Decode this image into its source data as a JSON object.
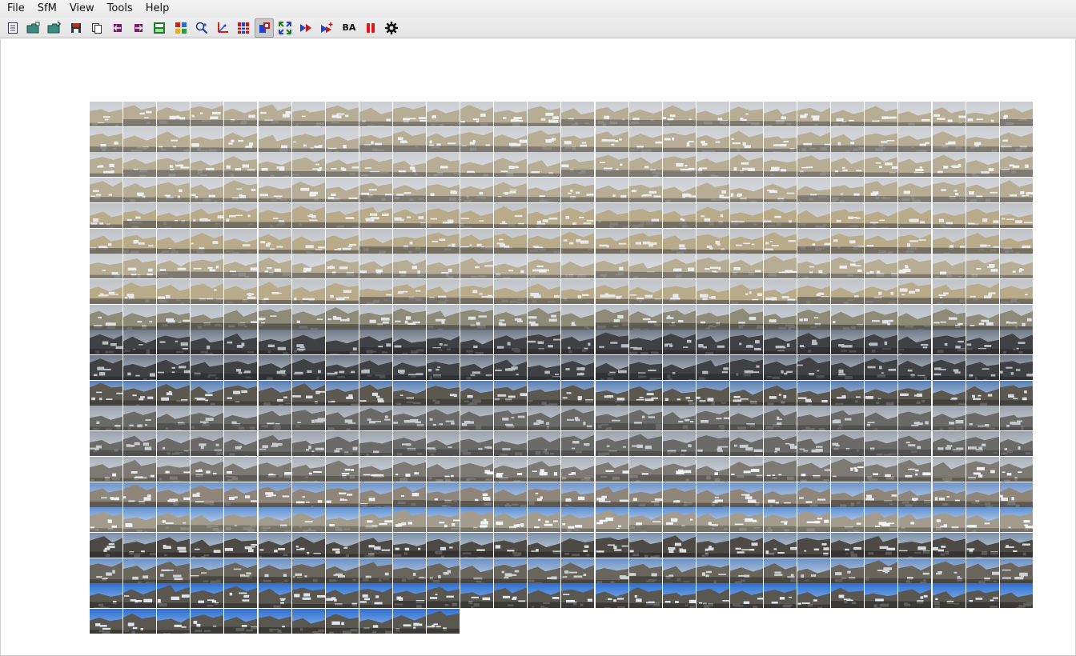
{
  "window": {
    "menu": [
      {
        "label": "File"
      },
      {
        "label": "SfM"
      },
      {
        "label": "View"
      },
      {
        "label": "Tools"
      },
      {
        "label": "Help"
      }
    ]
  },
  "toolbar": {
    "buttons": [
      {
        "icon": "new-workspace-icon"
      },
      {
        "icon": "open-folder-icon"
      },
      {
        "icon": "load-images-icon"
      },
      {
        "icon": "save-icon"
      },
      {
        "icon": "copy-icon"
      },
      {
        "icon": "import-icon"
      },
      {
        "icon": "export-icon"
      },
      {
        "icon": "2d-3d-toggle-icon"
      },
      {
        "icon": "image-grid-icon"
      },
      {
        "icon": "zoom-search-icon"
      },
      {
        "icon": "feature-match-icon"
      },
      {
        "icon": "match-matrix-icon"
      },
      {
        "icon": "image-group-icon",
        "active": true
      },
      {
        "icon": "expand-arrows-icon"
      },
      {
        "icon": "compute-sparse-icon"
      },
      {
        "icon": "add-images-icon"
      },
      {
        "icon": "bundle-adjust-icon",
        "text": "BA"
      },
      {
        "icon": "pause-icon"
      },
      {
        "icon": "settings-gear-icon"
      }
    ]
  },
  "colors": {
    "menubar": "#ececec",
    "toolbar": "#e8e8e8",
    "canvas": "#ffffff",
    "pause": "#e01818",
    "icon_blue": "#2255cc"
  },
  "thumbnails": {
    "rows": [
      {
        "count": 28,
        "tone": "snow-town"
      },
      {
        "count": 28,
        "tone": "snow-town"
      },
      {
        "count": 28,
        "tone": "snow-town"
      },
      {
        "count": 28,
        "tone": "snow-town"
      },
      {
        "count": 28,
        "tone": "castle"
      },
      {
        "count": 28,
        "tone": "castle"
      },
      {
        "count": 28,
        "tone": "snow-town"
      },
      {
        "count": 28,
        "tone": "castle"
      },
      {
        "count": 28,
        "tone": "castle-mixed"
      },
      {
        "count": 28,
        "tone": "dark-sky"
      },
      {
        "count": 28,
        "tone": "dark-sky"
      },
      {
        "count": 28,
        "tone": "walls-blue"
      },
      {
        "count": 28,
        "tone": "grey-town"
      },
      {
        "count": 28,
        "tone": "grey-town"
      },
      {
        "count": 28,
        "tone": "snow-roofs"
      },
      {
        "count": 28,
        "tone": "towers"
      },
      {
        "count": 28,
        "tone": "courtyard"
      },
      {
        "count": 28,
        "tone": "bridge"
      },
      {
        "count": 28,
        "tone": "stone-walls"
      },
      {
        "count": 28,
        "tone": "blue-sky"
      },
      {
        "count": 11,
        "tone": "blue-sky"
      }
    ]
  }
}
